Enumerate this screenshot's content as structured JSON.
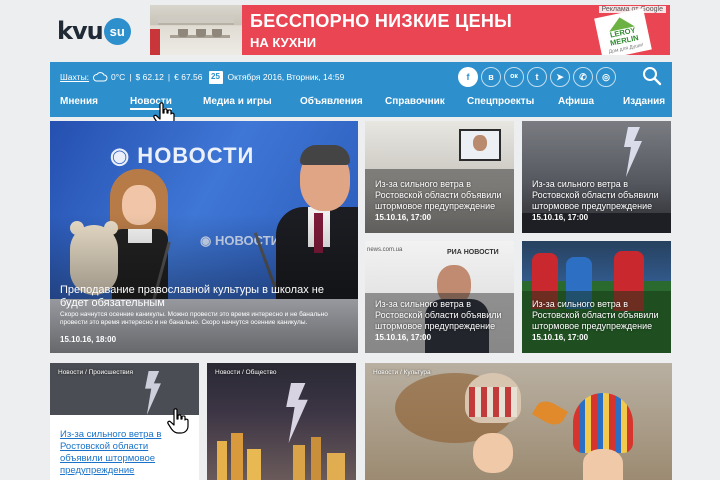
{
  "brand": {
    "logo_text": "kvu",
    "logo_suffix": "su"
  },
  "ad": {
    "headline": "БЕССПОРНО НИЗКИЕ ЦЕНЫ",
    "subline": "НА КУХНИ",
    "label": "Реклама от Google",
    "logo_brand": "LEROY MERLIN",
    "logo_slogan": "Дом для Души!"
  },
  "info": {
    "city": "Шахты:",
    "weather": "0°C",
    "usd": "$ 62.12",
    "eur": "€ 67.56",
    "day": "25",
    "date": "Октября 2016, Вторник, 14:59"
  },
  "socials": [
    {
      "icon": "facebook-icon",
      "glyph": "f"
    },
    {
      "icon": "vkontakte-icon",
      "glyph": "в"
    },
    {
      "icon": "odnoklassniki-icon",
      "glyph": "ок"
    },
    {
      "icon": "twitter-icon",
      "glyph": "t"
    },
    {
      "icon": "telegram-icon",
      "glyph": "➤"
    },
    {
      "icon": "whatsapp-icon",
      "glyph": "✆"
    },
    {
      "icon": "instagram-icon",
      "glyph": "◎"
    }
  ],
  "nav": [
    {
      "label": "Мнения"
    },
    {
      "label": "Новости",
      "active": true
    },
    {
      "label": "Медиа и игры"
    },
    {
      "label": "Объявления"
    },
    {
      "label": "Справочник"
    },
    {
      "label": "Спецпроекты"
    },
    {
      "label": "Афиша"
    },
    {
      "label": "Издания"
    }
  ],
  "feature": {
    "title": "Преподавание православной культуры в школах не будет обязательным",
    "lead": "Скоро начнутся осенние каникулы. Можно провести это время интересно и не банально провести это время интересно и не банально. Скоро начнутся осенние каникулы.",
    "date": "15.10.16, 18:00"
  },
  "tiles": [
    {
      "title": "Из-за сильного ветра в Ростовской области объявили штормовое предупреждение",
      "date": "15.10.16, 17:00"
    },
    {
      "title": "Из-за сильного ветра в Ростовской области объявили штормовое предупреждение",
      "date": "15.10.16, 17:00"
    },
    {
      "title": "Из-за сильного ветра в Ростовской области объявили штормовое предупреждение",
      "date": "15.10.16, 17:00"
    },
    {
      "title": "Из-за сильного ветра в Ростовской области объявили штормовое предупреждение",
      "date": "15.10.16, 17:00"
    }
  ],
  "bottom": [
    {
      "section": "Новости / Происшествия",
      "title": "Из-за сильного ветра в Ростовской области объявили штормовое предупреждение"
    },
    {
      "section": "Новости / Общество"
    },
    {
      "section": "Новости / Культура"
    }
  ],
  "colors": {
    "accent": "#2d8fcb",
    "ad_red": "#e94553",
    "link": "#1a73c8"
  }
}
